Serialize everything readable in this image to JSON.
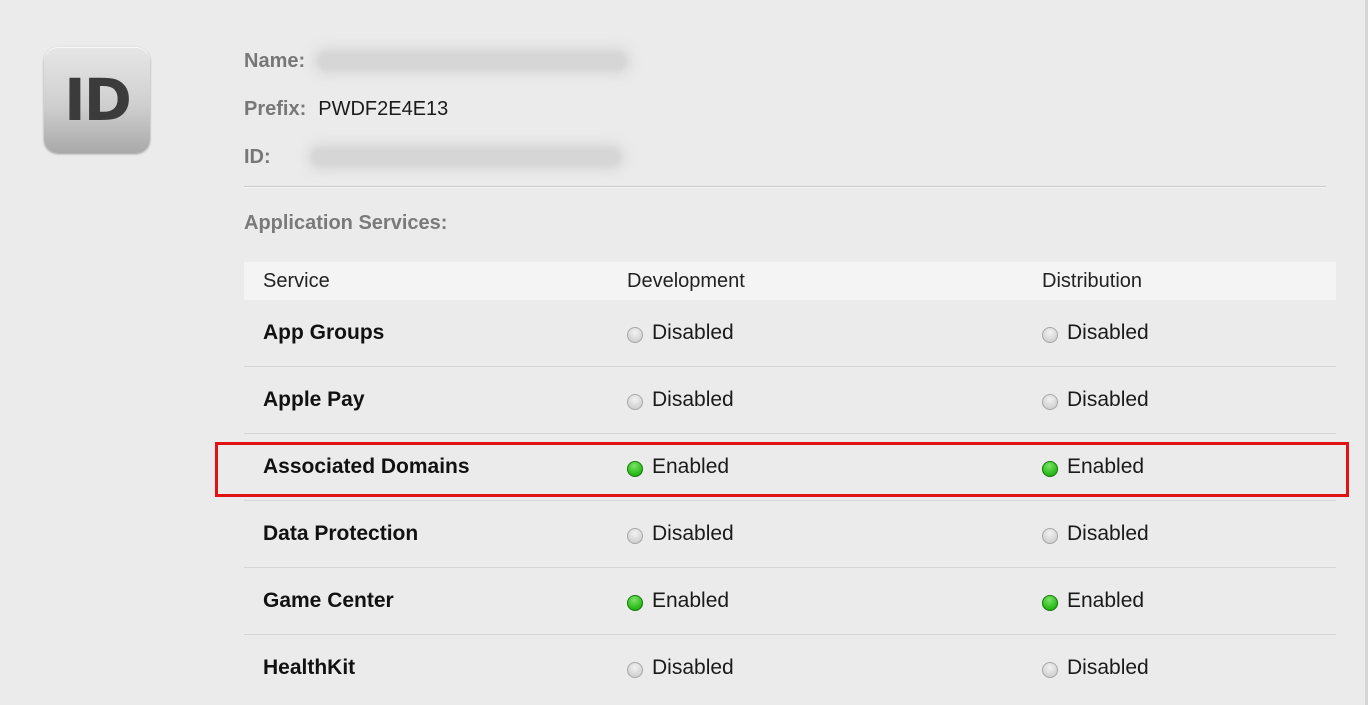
{
  "badge": {
    "text": "ID"
  },
  "meta": {
    "name_label": "Name:",
    "prefix_label": "Prefix:",
    "prefix_value": "PWDF2E4E13",
    "id_label": "ID:"
  },
  "section": {
    "title": "Application Services:"
  },
  "table": {
    "headers": [
      "Service",
      "Development",
      "Distribution"
    ],
    "rows": [
      {
        "service": "App Groups",
        "development": "Disabled",
        "distribution": "Disabled",
        "dev_state": "off",
        "dist_state": "off"
      },
      {
        "service": "Apple Pay",
        "development": "Disabled",
        "distribution": "Disabled",
        "dev_state": "off",
        "dist_state": "off"
      },
      {
        "service": "Associated Domains",
        "development": "Enabled",
        "distribution": "Enabled",
        "dev_state": "on",
        "dist_state": "on",
        "highlighted": true
      },
      {
        "service": "Data Protection",
        "development": "Disabled",
        "distribution": "Disabled",
        "dev_state": "off",
        "dist_state": "off"
      },
      {
        "service": "Game Center",
        "development": "Enabled",
        "distribution": "Enabled",
        "dev_state": "on",
        "dist_state": "on"
      },
      {
        "service": "HealthKit",
        "development": "Disabled",
        "distribution": "Disabled",
        "dev_state": "off",
        "dist_state": "off"
      }
    ]
  },
  "colors": {
    "enabled_dot": "#2fbf1f",
    "disabled_dot": "#cfcfcf",
    "highlight_border": "#e21212"
  }
}
